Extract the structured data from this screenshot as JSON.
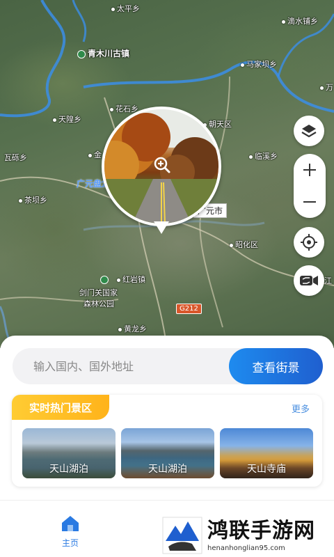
{
  "map": {
    "places": [
      {
        "name": "太平乡",
        "dot": true
      },
      {
        "name": "滴水铺乡",
        "dot": true
      },
      {
        "name": "青木川古镇",
        "poi": true
      },
      {
        "name": "马家坝乡",
        "dot": true
      },
      {
        "name": "万",
        "dot": true
      },
      {
        "name": "花石乡",
        "dot": true
      },
      {
        "name": "天隍乡",
        "dot": true
      },
      {
        "name": "朝天区",
        "dot": true
      },
      {
        "name": "瓦砾乡",
        "dot": false
      },
      {
        "name": "金",
        "dot": true
      },
      {
        "name": "临溪乡",
        "dot": true
      },
      {
        "name": "茶坝乡",
        "dot": true
      },
      {
        "name": "昭化区",
        "dot": true
      },
      {
        "name": "红岩镇",
        "dot": true
      },
      {
        "name": "剑门关国家",
        "poi": true
      },
      {
        "name": "森林公园",
        "poi": false
      },
      {
        "name": "黄龙乡",
        "dot": true
      },
      {
        "name": "江",
        "dot": false
      }
    ],
    "park_label": "广元盘龙机",
    "city_label": "广元市",
    "road_sign": "G212"
  },
  "controls": {
    "layers": "layers-icon",
    "zoom_in": "+",
    "zoom_out": "−",
    "locate": "locate-icon",
    "camera": "camera-switch-icon"
  },
  "search": {
    "placeholder": "输入国内、国外地址",
    "button": "查看街景"
  },
  "hot": {
    "title": "实时热门景区",
    "more": "更多",
    "cards": [
      {
        "label": "天山湖泊"
      },
      {
        "label": "天山湖泊"
      },
      {
        "label": "天山寺庙"
      }
    ]
  },
  "nav": {
    "home_label": "主页"
  },
  "watermark": {
    "title": "鸿联手游网",
    "url": "henanhonglian95.com"
  },
  "colors": {
    "accent": "#1f6fe0",
    "hot_title_bg": "#ffbf22"
  }
}
